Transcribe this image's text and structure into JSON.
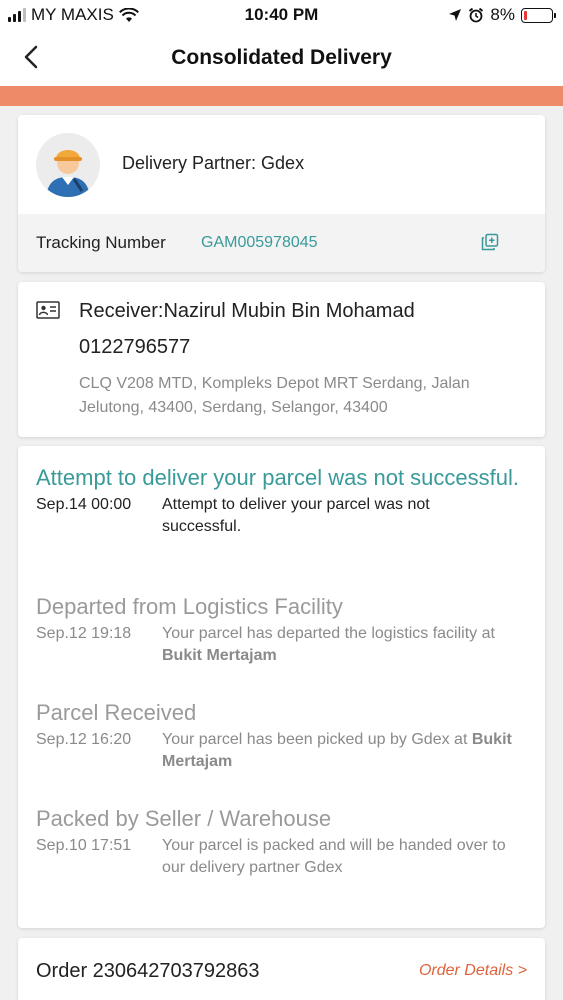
{
  "status_bar": {
    "carrier": "MY MAXIS",
    "time": "10:40 PM",
    "battery_percent": "8%",
    "battery_level": 0.08
  },
  "nav": {
    "title": "Consolidated Delivery",
    "back_icon": "chevron-left-icon"
  },
  "delivery": {
    "partner_text": "Delivery Partner: Gdex",
    "tracking_label": "Tracking Number",
    "tracking_number": "GAM005978045",
    "copy_icon": "copy-icon"
  },
  "receiver": {
    "name_line": "Receiver:Nazirul Mubin Bin Mohamad",
    "phone": "0122796577",
    "address": "CLQ V208 MTD, Kompleks Depot MRT Serdang, Jalan Jelutong, 43400, Serdang, Selangor, 43400"
  },
  "tracking_events": [
    {
      "heading": "Attempt to deliver your parcel was not successful.",
      "time": "Sep.14 00:00",
      "description": "Attempt to deliver your parcel was not successful.",
      "location": ""
    },
    {
      "heading": "Departed from Logistics Facility",
      "time": "Sep.12 19:18",
      "description": "Your parcel has departed the logistics facility at ",
      "location": "Bukit Mertajam"
    },
    {
      "heading": "Parcel Received",
      "time": "Sep.12 16:20",
      "description": "Your parcel has been picked up by Gdex at ",
      "location": "Bukit Mertajam"
    },
    {
      "heading": "Packed by Seller / Warehouse",
      "time": "Sep.10 17:51",
      "description": "Your parcel is packed and will be handed over to our delivery partner Gdex",
      "location": ""
    }
  ],
  "order": {
    "label": "Order 230642703792863",
    "link": "Order Details >"
  },
  "colors": {
    "accent_orange": "#ee8a67",
    "teal": "#3a9a9a",
    "link_orange": "#e0623a",
    "battery_low": "#e53935"
  }
}
